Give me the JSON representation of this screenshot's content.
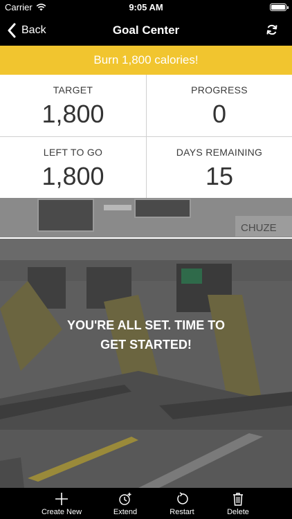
{
  "status_bar": {
    "carrier": "Carrier",
    "time": "9:05 AM"
  },
  "nav": {
    "back_label": "Back",
    "title": "Goal Center"
  },
  "goal": {
    "banner": "Burn 1,800 calories!"
  },
  "stats": [
    {
      "label": "TARGET",
      "value": "1,800"
    },
    {
      "label": "PROGRESS",
      "value": "0"
    },
    {
      "label": "LEFT  TO GO",
      "value": "1,800"
    },
    {
      "label": "DAYS REMAINING",
      "value": "15"
    }
  ],
  "hero": {
    "line1": "YOU'RE ALL SET. TIME TO",
    "line2": "GET STARTED!",
    "sign_text": "CHUZE"
  },
  "tabs": [
    {
      "label": "Create New",
      "icon": "plus-icon"
    },
    {
      "label": "Extend",
      "icon": "clock-plus-icon"
    },
    {
      "label": "Restart",
      "icon": "restart-icon"
    },
    {
      "label": "Delete",
      "icon": "trash-icon"
    }
  ],
  "colors": {
    "accent": "#f1c52f",
    "bar": "#000000",
    "text": "#333333"
  }
}
